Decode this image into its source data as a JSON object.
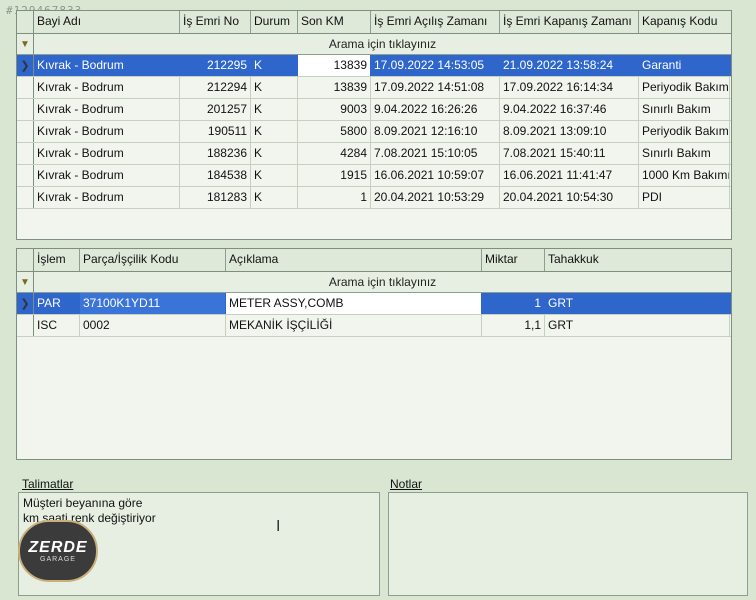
{
  "watermark": "#129467833",
  "orders": {
    "columns": [
      "Bayi Adı",
      "İş Emri No",
      "Durum",
      "Son KM",
      "İş Emri Açılış Zamanı",
      "İş Emri Kapanış Zamanı",
      "Kapanış Kodu"
    ],
    "filter_text": "Arama için tıklayınız",
    "rows": [
      [
        "Kıvrak - Bodrum",
        "212295",
        "K",
        "13839",
        "17.09.2022 14:53:05",
        "21.09.2022 13:58:24",
        "Garanti"
      ],
      [
        "Kıvrak - Bodrum",
        "212294",
        "K",
        "13839",
        "17.09.2022 14:51:08",
        "17.09.2022 16:14:34",
        "Periyodik Bakım"
      ],
      [
        "Kıvrak - Bodrum",
        "201257",
        "K",
        "9003",
        "9.04.2022 16:26:26",
        "9.04.2022 16:37:46",
        "Sınırlı Bakım"
      ],
      [
        "Kıvrak - Bodrum",
        "190511",
        "K",
        "5800",
        "8.09.2021 12:16:10",
        "8.09.2021 13:09:10",
        "Periyodik Bakım"
      ],
      [
        "Kıvrak - Bodrum",
        "188236",
        "K",
        "4284",
        "7.08.2021 15:10:05",
        "7.08.2021 15:40:11",
        "Sınırlı Bakım"
      ],
      [
        "Kıvrak - Bodrum",
        "184538",
        "K",
        "1915",
        "16.06.2021 10:59:07",
        "16.06.2021 11:41:47",
        "1000 Km Bakımı"
      ],
      [
        "Kıvrak - Bodrum",
        "181283",
        "K",
        "1",
        "20.04.2021 10:53:29",
        "20.04.2021 10:54:30",
        "PDI"
      ]
    ]
  },
  "parts": {
    "columns": [
      "İşlem",
      "Parça/İşçilik Kodu",
      "Açıklama",
      "Miktar",
      "Tahakkuk"
    ],
    "filter_text": "Arama için tıklayınız",
    "rows": [
      [
        "PAR",
        "37100K1YD11",
        "METER ASSY,COMB",
        "1",
        "GRT"
      ],
      [
        "ISC",
        "0002",
        "MEKANİK İŞÇİLİĞİ",
        "1,1",
        "GRT"
      ]
    ]
  },
  "instructions": {
    "title": "Talimatlar",
    "line1": "Müşteri beyanına göre",
    "line2": "km saati renk değiştiriyor"
  },
  "notes": {
    "title": "Notlar",
    "text": ""
  },
  "logo": {
    "name": "ZERDE",
    "sub": "GARAGE"
  }
}
